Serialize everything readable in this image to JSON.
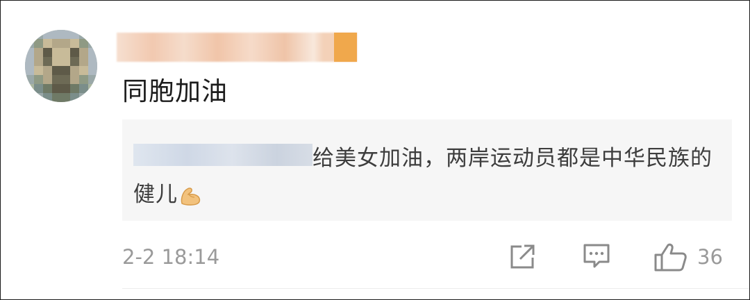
{
  "comment": {
    "text": "同胞加油",
    "timestamp": "2-2 18:14"
  },
  "reply": {
    "text": "给美女加油，两岸运动员都是中华民族的健儿"
  },
  "actions": {
    "like_count": "36",
    "share_icon": "share-icon",
    "comment_icon": "comment-icon",
    "like_icon": "thumbs-up-icon"
  },
  "colors": {
    "accent_tag": "#f0a84c",
    "secondary_text": "#9a9a9a",
    "reply_bg": "#f6f6f6"
  }
}
